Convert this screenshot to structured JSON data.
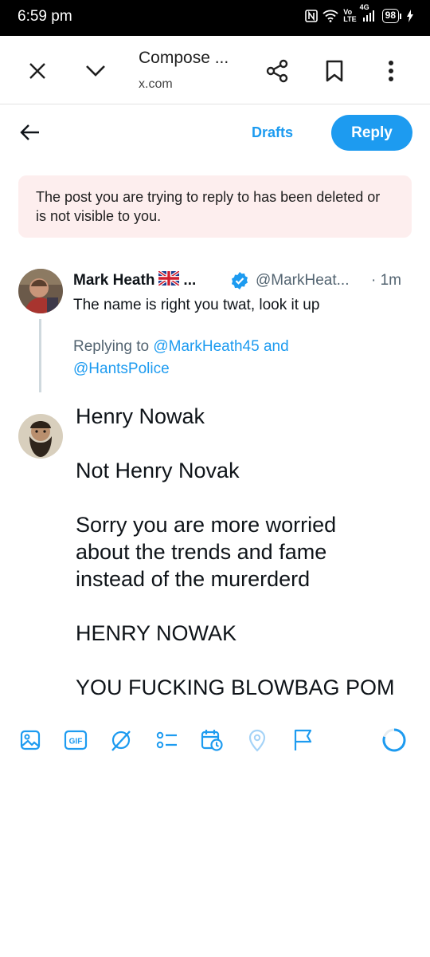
{
  "status_bar": {
    "time": "6:59 pm",
    "network_top": "Vo",
    "network_bottom": "LTE",
    "network_gen": "4G",
    "battery": "98"
  },
  "browser": {
    "title": "Compose ...",
    "url": "x.com",
    "icons": [
      "close-icon",
      "chevron-down-icon",
      "share-icon",
      "bookmark-icon",
      "more-vert-icon"
    ]
  },
  "compose_header": {
    "drafts_label": "Drafts",
    "reply_label": "Reply"
  },
  "notice": {
    "text": "The post you are trying to reply to has been deleted or is not visible to you."
  },
  "original_tweet": {
    "author_name": "Mark Heath",
    "name_suffix": "...",
    "handle": "@MarkHeat...",
    "time": "· 1m",
    "text": "The name is right you twat, look it up",
    "replying_prefix": "Replying to ",
    "replying_handle1": "@MarkHeath45",
    "replying_and": " and",
    "replying_handle2": "@HantsPolice"
  },
  "compose": {
    "lines": [
      "Henry Nowak",
      "",
      "Not Henry Novak",
      "",
      "Sorry you are more worried",
      "about the trends and fame",
      "instead of the murerderd",
      "",
      "HENRY NOWAK",
      "",
      "YOU FUCKING BLOWBAG POM"
    ]
  },
  "toolbar": {
    "icons": [
      "image-icon",
      "gif-icon",
      "grok-icon",
      "poll-icon",
      "schedule-icon",
      "location-icon",
      "flag-icon",
      "progress-ring-icon"
    ],
    "gif_label": "GIF"
  },
  "colors": {
    "accent": "#1d9bf0",
    "notice_bg": "#fdeeee",
    "secondary_text": "#536471"
  }
}
